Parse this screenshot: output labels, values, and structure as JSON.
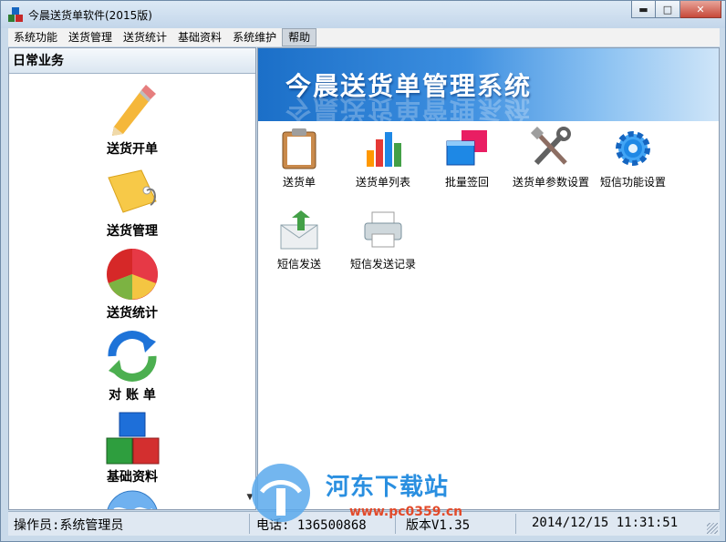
{
  "window": {
    "title": "今晨送货单软件(2015版)",
    "minimize": "▬",
    "maximize": "□",
    "close": "✕"
  },
  "menu": {
    "items": [
      {
        "label": "系统功能"
      },
      {
        "label": "送货管理"
      },
      {
        "label": "送货统计"
      },
      {
        "label": "基础资料"
      },
      {
        "label": "系统维护"
      },
      {
        "label": "帮助"
      }
    ]
  },
  "sidebar": {
    "header": "日常业务",
    "items": [
      {
        "label": "送货开单",
        "icon": "pencil-icon"
      },
      {
        "label": "送货管理",
        "icon": "tag-icon"
      },
      {
        "label": "送货统计",
        "icon": "pie-chart-icon"
      },
      {
        "label": "对 账 单",
        "icon": "sync-icon"
      },
      {
        "label": "基础资料",
        "icon": "blocks-icon"
      }
    ]
  },
  "main": {
    "banner_title": "今晨送货单管理系统",
    "tools": [
      {
        "label": "送货单",
        "icon": "clipboard-icon"
      },
      {
        "label": "送货单列表",
        "icon": "bar-chart-icon"
      },
      {
        "label": "批量签回",
        "icon": "windows-icon"
      },
      {
        "label": "送货单参数设置",
        "icon": "tools-icon"
      },
      {
        "label": "短信功能设置",
        "icon": "gear-icon"
      },
      {
        "label": "短信发送",
        "icon": "envelope-icon"
      },
      {
        "label": "短信发送记录",
        "icon": "printer-icon"
      }
    ]
  },
  "status": {
    "operator": "操作员:系统管理员",
    "phone": "电话: 136500868",
    "version": "版本V1.35",
    "datetime": "2014/12/15 11:31:51"
  },
  "watermark": {
    "text": "河东下载站",
    "url": "www.pc0359.cn"
  },
  "colors": {
    "accent": "#1b6fc8",
    "window_frame": "#c9daea"
  }
}
